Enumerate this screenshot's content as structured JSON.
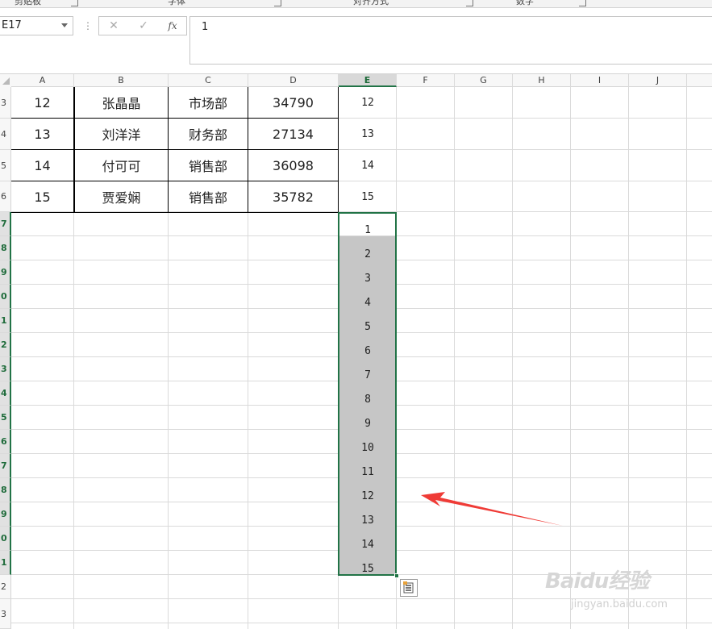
{
  "ribbon": {
    "groups": [
      {
        "label": "剪贴板"
      },
      {
        "label": "字体"
      },
      {
        "label": "对齐方式"
      },
      {
        "label": "数字"
      }
    ]
  },
  "formula_bar": {
    "name_box": "E17",
    "cancel_icon": "✕",
    "enter_icon": "✓",
    "fx_label": "fx",
    "formula_value": "1"
  },
  "columns": [
    "A",
    "B",
    "C",
    "D",
    "E",
    "F",
    "G",
    "H",
    "I",
    "J"
  ],
  "selected_column": "E",
  "rows": [
    "3",
    "4",
    "5",
    "6",
    "7",
    "8",
    "9",
    "0",
    "1",
    "2",
    "3",
    "4",
    "5",
    "6",
    "7",
    "8",
    "9",
    "0",
    "1",
    "2",
    "3"
  ],
  "table_rows": [
    {
      "a": "12",
      "b": "张晶晶",
      "c": "市场部",
      "d": "34790",
      "e": "12"
    },
    {
      "a": "13",
      "b": "刘洋洋",
      "c": "财务部",
      "d": "27134",
      "e": "13"
    },
    {
      "a": "14",
      "b": "付可可",
      "c": "销售部",
      "d": "36098",
      "e": "14"
    },
    {
      "a": "15",
      "b": "贾爱娴",
      "c": "销售部",
      "d": "35782",
      "e": "15"
    }
  ],
  "filled_series": [
    "1",
    "2",
    "3",
    "4",
    "5",
    "6",
    "7",
    "8",
    "9",
    "10",
    "11",
    "12",
    "13",
    "14",
    "15"
  ],
  "annotation_color": "#ef3b36",
  "accent_color": "#217346",
  "watermark": {
    "text": "Baidu经验",
    "sub": "jingyan.baidu.com"
  }
}
